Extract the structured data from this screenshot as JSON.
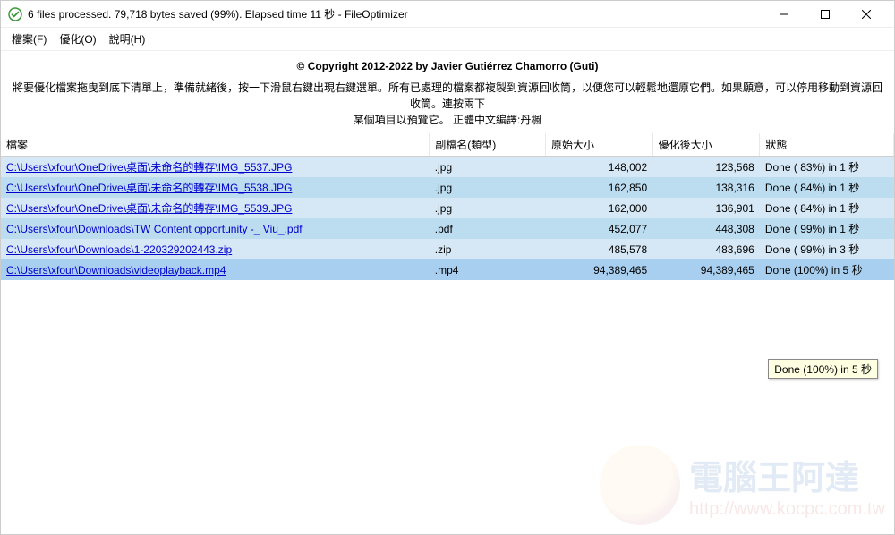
{
  "titlebar": {
    "title": "6 files processed. 79,718 bytes saved (99%). Elapsed time  11 秒 - FileOptimizer"
  },
  "menu": {
    "file": "檔案(F)",
    "optimize": "優化(O)",
    "help": "說明(H)"
  },
  "copyright": "© Copyright 2012-2022 by Javier Gutiérrez Chamorro (Guti)",
  "instructions_line1": "將要優化檔案拖曳到底下清單上，準備就緒後，按一下滑鼠右鍵出現右鍵選單。所有已處理的檔案都複製到資源回收筒，以便您可以輕鬆地還原它們。如果願意，可以停用移動到資源回收筒。連按兩下",
  "instructions_line2": "某個項目以預覽它。                                                正體中文編譯:丹楓",
  "columns": {
    "file": "檔案",
    "ext": "副檔名(類型)",
    "orig": "原始大小",
    "opt": "優化後大小",
    "status": "狀態"
  },
  "rows": [
    {
      "path": "C:\\Users\\xfour\\OneDrive\\桌面\\未命名的轉存\\IMG_5537.JPG",
      "ext": ".jpg",
      "orig": "148,002",
      "opt": "123,568",
      "status": "Done ( 83%) in  1 秒"
    },
    {
      "path": "C:\\Users\\xfour\\OneDrive\\桌面\\未命名的轉存\\IMG_5538.JPG",
      "ext": ".jpg",
      "orig": "162,850",
      "opt": "138,316",
      "status": "Done ( 84%) in  1 秒"
    },
    {
      "path": "C:\\Users\\xfour\\OneDrive\\桌面\\未命名的轉存\\IMG_5539.JPG",
      "ext": ".jpg",
      "orig": "162,000",
      "opt": "136,901",
      "status": "Done ( 84%) in  1 秒"
    },
    {
      "path": "C:\\Users\\xfour\\Downloads\\TW Content opportunity -_ Viu_.pdf",
      "ext": ".pdf",
      "orig": "452,077",
      "opt": "448,308",
      "status": "Done ( 99%) in  1 秒"
    },
    {
      "path": "C:\\Users\\xfour\\Downloads\\1-220329202443.zip",
      "ext": ".zip",
      "orig": "485,578",
      "opt": "483,696",
      "status": "Done ( 99%) in  3 秒"
    },
    {
      "path": "C:\\Users\\xfour\\Downloads\\videoplayback.mp4",
      "ext": ".mp4",
      "orig": "94,389,465",
      "opt": "94,389,465",
      "status": "Done (100%) in  5 秒"
    }
  ],
  "tooltip": "Done (100%) in  5 秒",
  "watermark": {
    "text": "電腦王阿達",
    "url": "http://www.kocpc.com.tw"
  }
}
